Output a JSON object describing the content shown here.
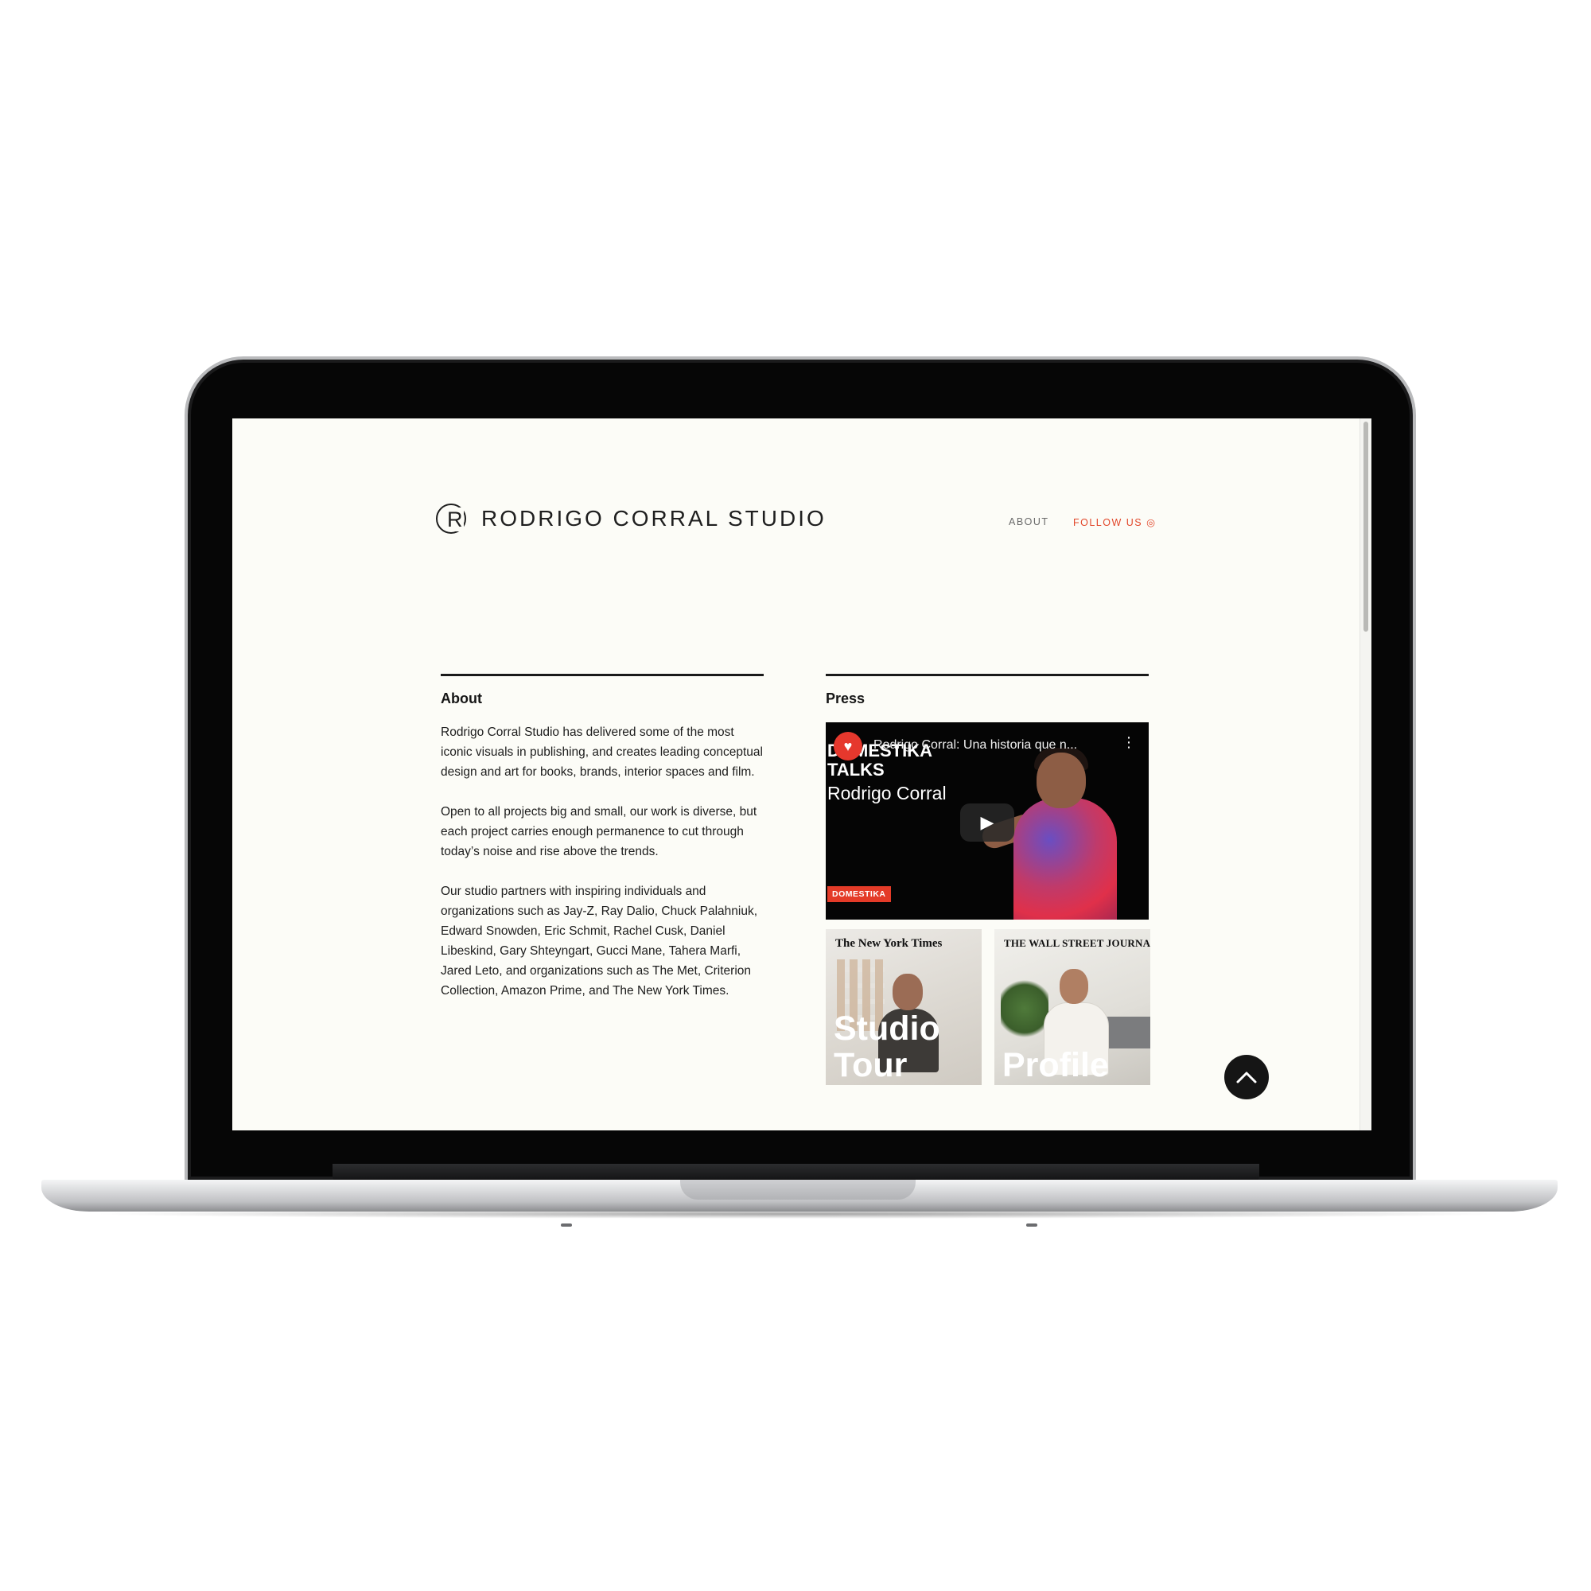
{
  "site": {
    "logo_mark": "R",
    "logo_text": "RODRIGO CORRAL STUDIO"
  },
  "nav": {
    "about": "ABOUT",
    "follow": "FOLLOW US ◎"
  },
  "about": {
    "heading": "About",
    "paragraphs": [
      "Rodrigo Corral Studio has delivered some of the most iconic visuals in publishing, and creates leading conceptual design and art for books, brands, interior spaces and film.",
      "Open to all projects big and small, our work is diverse, but each project carries enough permanence to cut through today’s noise and rise above the trends.",
      "Our studio partners with inspiring individuals and organizations such as Jay-Z, Ray Dalio, Chuck Palahniuk, Edward Snowden, Eric Schmit, Rachel Cusk, Daniel Libeskind, Gary Shteyngart, Gucci Mane, Tahera Marfi, Jared Leto, and organizations such as The Met, Criterion Collection, Amazon Prime, and The New York Times."
    ]
  },
  "press": {
    "heading": "Press",
    "video": {
      "title": "Rodrigo Corral: Una historia que n...",
      "overlay_line1": "DOMESTIKA",
      "overlay_line2": "TALKS",
      "overlay_name": "Rodrigo Corral",
      "badge": "DOMESTIKA"
    },
    "thumbnails": [
      {
        "masthead": "The New York Times",
        "label_line1": "Studio",
        "label_line2": "Tour"
      },
      {
        "masthead": "THE WALL STREET JOURNAL.",
        "label_line1": "Profile"
      }
    ]
  },
  "colors": {
    "accent": "#e2472a",
    "page_bg": "#fcfcf7",
    "text": "#1d1d1d"
  },
  "icons": {
    "logo": "circle-r-icon",
    "video_channel": "domestika-icon",
    "video_menu": "kebab-menu-icon",
    "play": "play-icon",
    "back_to_top": "chevron-up-icon"
  }
}
